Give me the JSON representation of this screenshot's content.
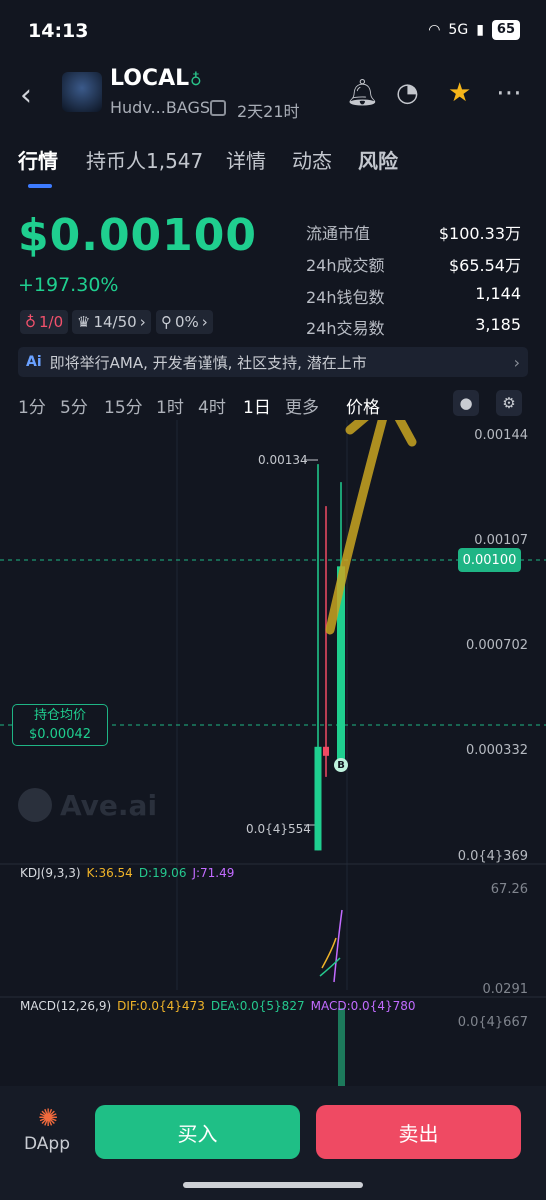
{
  "status": {
    "time": "14:13",
    "network": "5G",
    "battery": "65"
  },
  "header": {
    "token_name": "LOCAL",
    "token_sub": "Hudv...BAGS",
    "age": "2天21时"
  },
  "tabs": [
    {
      "label": "行情"
    },
    {
      "label": "持币人1,547"
    },
    {
      "label": "详情"
    },
    {
      "label": "动态"
    },
    {
      "label": "风险"
    }
  ],
  "price": {
    "value": "$0.00100",
    "change": "+197.30%"
  },
  "stats": [
    {
      "label": "流通市值",
      "value": "$100.33万"
    },
    {
      "label": "24h成交额",
      "value": "$65.54万"
    },
    {
      "label": "24h钱包数",
      "value": "1,144"
    },
    {
      "label": "24h交易数",
      "value": "3,185"
    }
  ],
  "chips": {
    "c1": "1/0",
    "c2": "14/50",
    "c3": "0%"
  },
  "ai_bar": {
    "tag": "Ai",
    "text": "即将举行AMA, 开发者谨慎, 社区支持, 潜在上市"
  },
  "timeframes": [
    "1分",
    "5分",
    "15分",
    "1时",
    "4时",
    "1日",
    "更多",
    "价格"
  ],
  "chart": {
    "axis": [
      "0.00144",
      "0.00107",
      "0.000702",
      "0.000332",
      "0.0{4}369"
    ],
    "current_price": "0.00100",
    "hold_label": "持仓均价",
    "hold_value": "$0.00042",
    "high_label": "0.00134",
    "low_label": "0.0{4}554",
    "watermark": "Ave.ai",
    "buy_marker": "B"
  },
  "chart_data": {
    "type": "candlestick",
    "x": [
      "day-1",
      "day-2",
      "day-3"
    ],
    "candles": [
      {
        "open": 0.0004,
        "high": 0.00134,
        "low": 5.54e-05,
        "close": 5.54e-05,
        "color": "#1fcf8f"
      },
      {
        "open": 0.0004,
        "high": 0.0012,
        "low": 0.0003,
        "close": 0.00037,
        "color": "#ef4a63"
      },
      {
        "open": 0.00035,
        "high": 0.00128,
        "low": 0.00033,
        "close": 0.001,
        "color": "#1fcf8f"
      }
    ],
    "ylim": [
      3.69e-05,
      0.00144
    ]
  },
  "kdj": {
    "title": "KDJ(9,3,3)",
    "k": "K:36.54",
    "d": "D:19.06",
    "j": "J:71.49",
    "axis_top": "67.26",
    "axis_bottom": "0.0291"
  },
  "macd": {
    "title": "MACD(12,26,9)",
    "dif": "DIF:0.0{4}473",
    "dea": "DEA:0.0{5}827",
    "macd": "MACD:0.0{4}780",
    "axis_top": "0.0{4}667"
  },
  "bottom": {
    "dapp": "DApp",
    "buy": "买入",
    "sell": "卖出"
  },
  "colors": {
    "up": "#1fcf8f",
    "down": "#ef4a63",
    "accent": "#3d7bff"
  }
}
